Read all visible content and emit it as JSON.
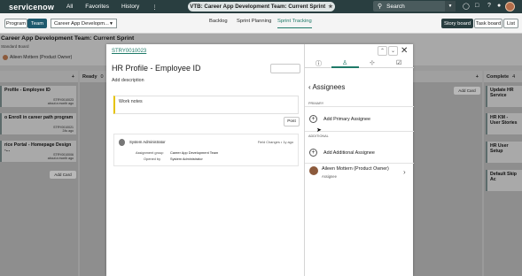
{
  "topbar": {
    "logo": "servicenow",
    "nav": [
      "All",
      "Favorites",
      "History"
    ],
    "more": "⋮",
    "context_title": "VTB: Career App Development Team: Current Sprint",
    "star": "★",
    "search_placeholder": "Search",
    "icons": [
      "globe-icon",
      "chat-icon",
      "help-icon",
      "bell-icon"
    ]
  },
  "subbar": {
    "view_buttons": [
      "Program",
      "Team"
    ],
    "team_select": "Career App Developm...",
    "tabs": [
      "Backlog",
      "Sprint Planning",
      "Sprint Tracking"
    ],
    "active_tab": "Sprint Tracking",
    "board_buttons": [
      "Story board",
      "Task board",
      "List"
    ]
  },
  "board": {
    "title": "Career App Development Team: Current Sprint",
    "subtitle": "Standard Board",
    "owner": "Aileen Mottern (Product Owner)",
    "columns": [
      {
        "label": ""
      },
      {
        "label": "Ready",
        "count": "0"
      },
      {
        "label": ""
      },
      {
        "label": "Complete",
        "count": "4"
      }
    ],
    "left_cards": [
      {
        "title": "Profile - Employee ID",
        "id": "STRY0010023",
        "when": "about a month ago"
      },
      {
        "title": "o Enroll in career path program",
        "id": "STRY0010021",
        "when": "24s ago"
      },
      {
        "title": "rice Portal - Homepage Design -...",
        "id": "STRY0010006",
        "when": "about a month ago"
      }
    ],
    "right_cards": [
      {
        "title": "Update HR Service"
      },
      {
        "title": "HR KM - User Stories"
      },
      {
        "title": "HR User Setup"
      },
      {
        "title": "Default Skip Ac"
      }
    ],
    "add_card": "Add Card"
  },
  "modal": {
    "story_id": "STRY0010023",
    "title": "HR Profile - Employee ID",
    "add_description": "Add description",
    "work_notes": "Work notes",
    "post": "Post",
    "activity": {
      "user": "System Administrator",
      "change": "Field Changes",
      "when": "1y ago",
      "rows": [
        {
          "label": "Assignment group",
          "value": "Career App Development Team"
        },
        {
          "label": "Opened by",
          "value": "System Administrator"
        }
      ]
    },
    "panel": {
      "heading": "Assignees",
      "primary_label": "PRIMARY",
      "add_primary": "Add Primary Assignee",
      "additional_label": "ADDITIONAL",
      "add_additional": "Add Additional Assignee",
      "assignee_name": "Aileen Mottern (Product Owner)",
      "assignee_role": "Assignee"
    }
  },
  "colors": {
    "header": "#293e40",
    "accent": "#1f7a68"
  }
}
